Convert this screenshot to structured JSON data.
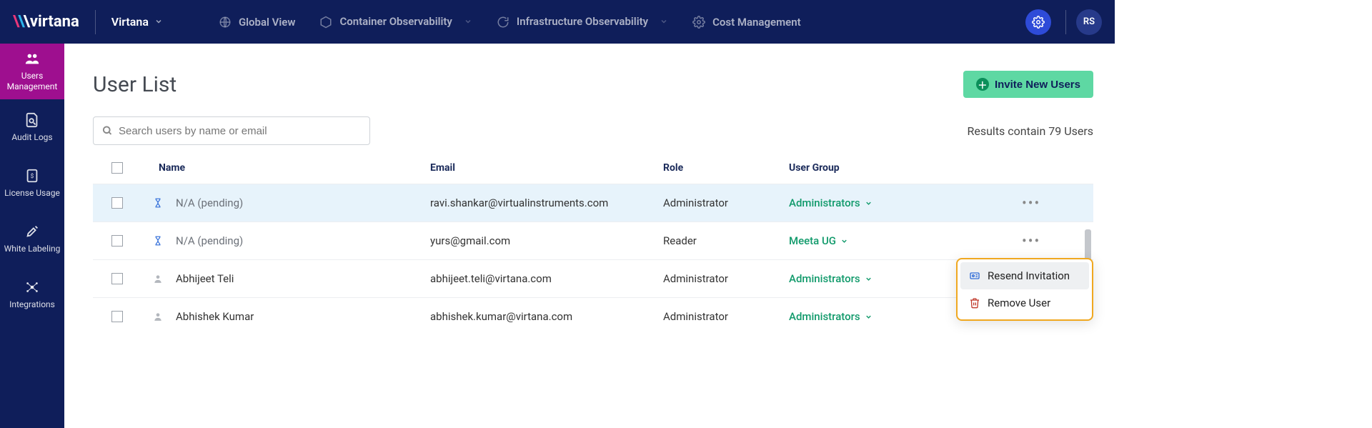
{
  "topbar": {
    "brand": "virtana",
    "org": "Virtana",
    "nav": [
      {
        "label": "Global View"
      },
      {
        "label": "Container Observability"
      },
      {
        "label": "Infrastructure Observability"
      },
      {
        "label": "Cost Management"
      }
    ],
    "avatar": "RS"
  },
  "sidebar": {
    "items": [
      {
        "label": "Users Management"
      },
      {
        "label": "Audit Logs"
      },
      {
        "label": "License Usage"
      },
      {
        "label": "White Labeling"
      },
      {
        "label": "Integrations"
      }
    ]
  },
  "page": {
    "title": "User List",
    "invite_btn": "Invite New Users",
    "search_placeholder": "Search users by name or email",
    "results_text": "Results contain 79 Users"
  },
  "table": {
    "headers": {
      "name": "Name",
      "email": "Email",
      "role": "Role",
      "group": "User Group"
    },
    "rows": [
      {
        "pending": true,
        "name": "N/A (pending)",
        "email": "ravi.shankar@virtualinstruments.com",
        "role": "Administrator",
        "group": "Administrators",
        "hover": true
      },
      {
        "pending": true,
        "name": "N/A (pending)",
        "email": "yurs@gmail.com",
        "role": "Reader",
        "group": "Meeta UG"
      },
      {
        "pending": false,
        "name": "Abhijeet Teli",
        "email": "abhijeet.teli@virtana.com",
        "role": "Administrator",
        "group": "Administrators"
      },
      {
        "pending": false,
        "name": "Abhishek Kumar",
        "email": "abhishek.kumar@virtana.com",
        "role": "Administrator",
        "group": "Administrators"
      }
    ]
  },
  "row_menu": {
    "resend": "Resend Invitation",
    "remove": "Remove User"
  }
}
